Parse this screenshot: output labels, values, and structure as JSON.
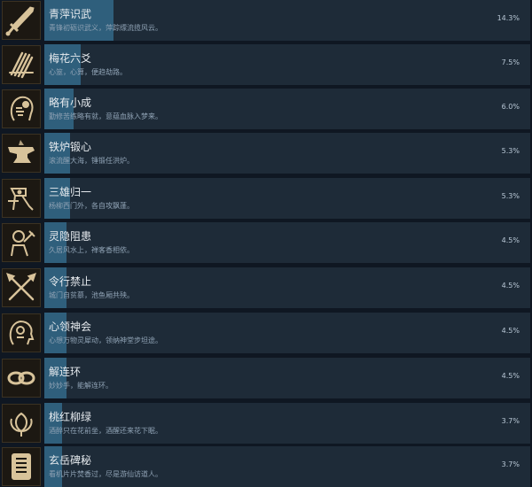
{
  "achievements": [
    {
      "title": "青萍识武",
      "desc": "青锋初砺识武义，萍踪缥流揽风云。",
      "percent_text": "14.3%",
      "percent": 14.3,
      "icon": "sword-icon"
    },
    {
      "title": "梅花六爻",
      "desc": "心筮，心算，便趋劫路。",
      "percent_text": "7.5%",
      "percent": 7.5,
      "icon": "divination-sticks-icon"
    },
    {
      "title": "略有小成",
      "desc": "勤修苦练略有就，意蕴血脉入梦来。",
      "percent_text": "6.0%",
      "percent": 6.0,
      "icon": "meditating-head-icon"
    },
    {
      "title": "铁炉锻心",
      "desc": "滚流醒大海，锤锻任洪炉。",
      "percent_text": "5.3%",
      "percent": 5.3,
      "icon": "anvil-icon"
    },
    {
      "title": "三雄归一",
      "desc": "杨柳西门外，各自攻飘蓬。",
      "percent_text": "5.3%",
      "percent": 5.3,
      "icon": "warrior-figure-icon"
    },
    {
      "title": "灵隐阻患",
      "desc": "久居风水上，禅客香相依。",
      "percent_text": "4.5%",
      "percent": 4.5,
      "icon": "monk-icon"
    },
    {
      "title": "令行禁止",
      "desc": "城门自贫慕，池鱼厢共殃。",
      "percent_text": "4.5%",
      "percent": 4.5,
      "icon": "crossed-spears-icon"
    },
    {
      "title": "心领神会",
      "desc": "心想万物灵犀动，领纳神堂步坦途。",
      "percent_text": "4.5%",
      "percent": 4.5,
      "icon": "mind-head-icon"
    },
    {
      "title": "解连环",
      "desc": "妙妙手，能解连环。",
      "percent_text": "4.5%",
      "percent": 4.5,
      "icon": "linked-rings-icon"
    },
    {
      "title": "桃红柳绿",
      "desc": "酒醉只在花前坐，酒醒还来花下眠。",
      "percent_text": "3.7%",
      "percent": 3.7,
      "icon": "flower-icon"
    },
    {
      "title": "玄岳碑秘",
      "desc": "看机片片焚香过，尽是游仙访道人。",
      "percent_text": "3.7%",
      "percent": 3.7,
      "icon": "stele-tablet-icon"
    }
  ],
  "colors": {
    "background": "#0f1722",
    "row_track": "#1e2b38",
    "progress_fill": "#2f5f7c",
    "icon_gold": "#d8c39a"
  }
}
